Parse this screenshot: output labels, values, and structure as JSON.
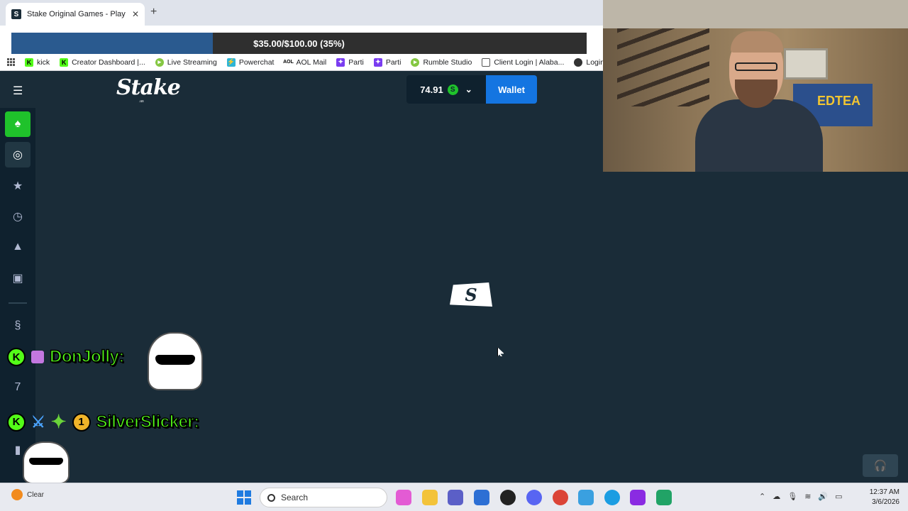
{
  "browser": {
    "tab_title": "Stake Original Games - Play Sol",
    "tab_favicon": "S",
    "progress": {
      "label": "$35.00/$100.00 (35%)",
      "fraction": 0.35
    },
    "bookmarks": [
      {
        "label": "kick",
        "icon": "kick-icon"
      },
      {
        "label": "Creator Dashboard |...",
        "icon": "kick-icon"
      },
      {
        "label": "Live Streaming",
        "icon": "live-icon"
      },
      {
        "label": "Powerchat",
        "icon": "powerchat-icon"
      },
      {
        "label": "AOL Mail",
        "icon": "aol-icon"
      },
      {
        "label": "Parti",
        "icon": "parti-icon"
      },
      {
        "label": "Parti",
        "icon": "parti-icon"
      },
      {
        "label": "Rumble Studio",
        "icon": "rumble-icon"
      },
      {
        "label": "Client Login | Alaba...",
        "icon": "document-icon"
      },
      {
        "label": "Login",
        "icon": "login-icon"
      }
    ]
  },
  "stake": {
    "logo": "Stake",
    "logo_sub": ".us",
    "balance": "74.91",
    "coin_symbol": "S",
    "wallet_label": "Wallet",
    "loader_glyph": "S"
  },
  "chat": [
    {
      "username": "DonJolly:",
      "badge": "K"
    },
    {
      "username": "SilverSlicker:",
      "badge": "K",
      "sub_badge": "1"
    }
  ],
  "webcam": {
    "flag_text": "EDTEA"
  },
  "taskbar": {
    "weather_label": "Clear",
    "search_placeholder": "Search",
    "time": "12:37 AM",
    "date": "3/6/2026"
  },
  "colors": {
    "stake_bg": "#1a2c38",
    "sidebar_bg": "#0f212e",
    "wallet_blue": "#1475e1",
    "kick_green": "#53fc18",
    "active_green": "#1fc22b"
  }
}
